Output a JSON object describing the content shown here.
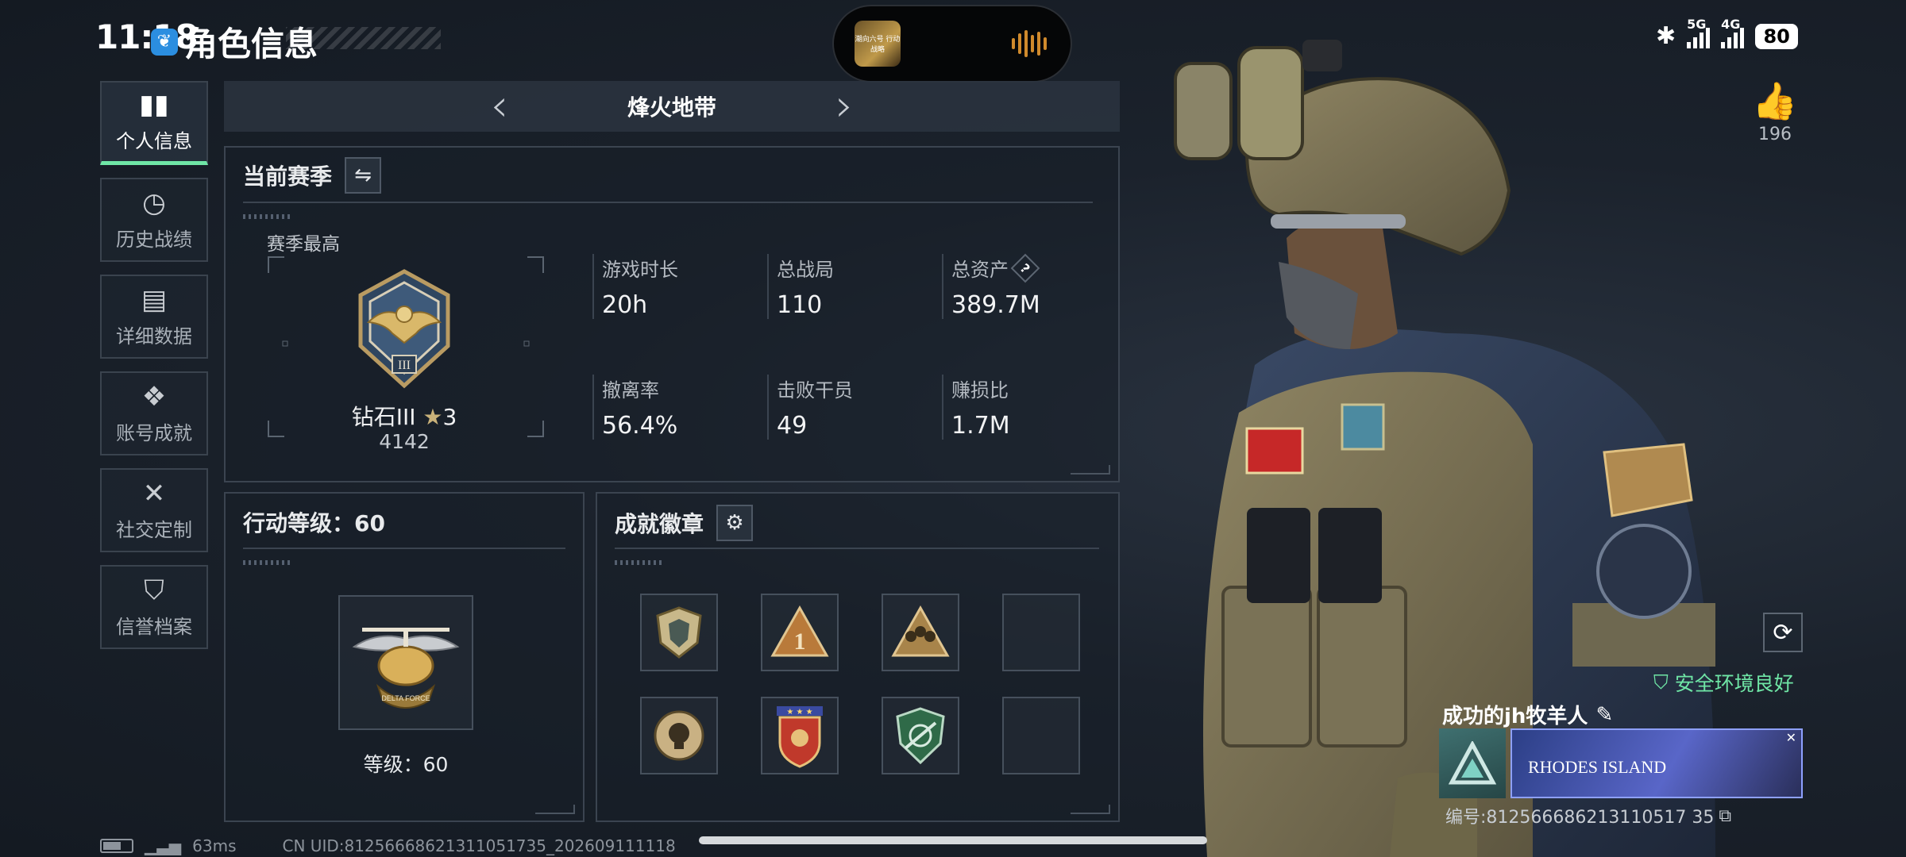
{
  "status_bar": {
    "time": "11:18",
    "battery": "80",
    "signal_1": "5G",
    "signal_2": "4G"
  },
  "page": {
    "title": "角色信息"
  },
  "island": {
    "thumb_text": "潮向六号 行动战略"
  },
  "nav": {
    "items": [
      {
        "label": "个人信息",
        "icon": "bar-chart-icon"
      },
      {
        "label": "历史战绩",
        "icon": "history-icon"
      },
      {
        "label": "详细数据",
        "icon": "folder-icon"
      },
      {
        "label": "账号成就",
        "icon": "medal-icon"
      },
      {
        "label": "社交定制",
        "icon": "tools-icon"
      },
      {
        "label": "信誉档案",
        "icon": "shield-icon"
      }
    ],
    "active": "个人信息"
  },
  "mode": {
    "name": "烽火地带"
  },
  "season": {
    "title": "当前赛季",
    "best_label": "赛季最高",
    "rank_name": "钻石III",
    "rank_stars": "3",
    "rank_points": "4142",
    "stats": [
      {
        "label": "游戏时长",
        "value": "20h"
      },
      {
        "label": "总战局",
        "value": "110"
      },
      {
        "label": "总资产",
        "value": "389.7M"
      },
      {
        "label": "撤离率",
        "value": "56.4%"
      },
      {
        "label": "击败干员",
        "value": "49"
      },
      {
        "label": "赚损比",
        "value": "1.7M"
      }
    ],
    "help_symbol": "?"
  },
  "action_level": {
    "title": "行动等级：60",
    "level_text": "等级：60",
    "emblem_text": "DELTA FORCE"
  },
  "badges": {
    "title": "成就徽章",
    "slots": [
      {
        "icon": "shield-badge-icon",
        "filled": true
      },
      {
        "icon": "rank-one-badge-icon",
        "filled": true
      },
      {
        "icon": "squad-badge-icon",
        "filled": true
      },
      {
        "icon": "empty-slot",
        "filled": false
      },
      {
        "icon": "skull-badge-icon",
        "filled": true
      },
      {
        "icon": "star-shield-badge-icon",
        "filled": true
      },
      {
        "icon": "rifle-badge-icon",
        "filled": true
      },
      {
        "icon": "empty-slot",
        "filled": false
      }
    ]
  },
  "profile": {
    "likes": "196",
    "safety_text": "安全环境良好",
    "player_name": "成功的jh牧羊人",
    "banner_text": "RHODES ISLAND",
    "id_text": "编号:812566686213110517 35"
  },
  "footer": {
    "ping": "63ms",
    "uid": "CN UID:812566686213110517​35_202609111118"
  },
  "colors": {
    "accent_green": "#6fe6a6",
    "panel_border": "#3b4450",
    "banner_blue": "#5966c8"
  }
}
